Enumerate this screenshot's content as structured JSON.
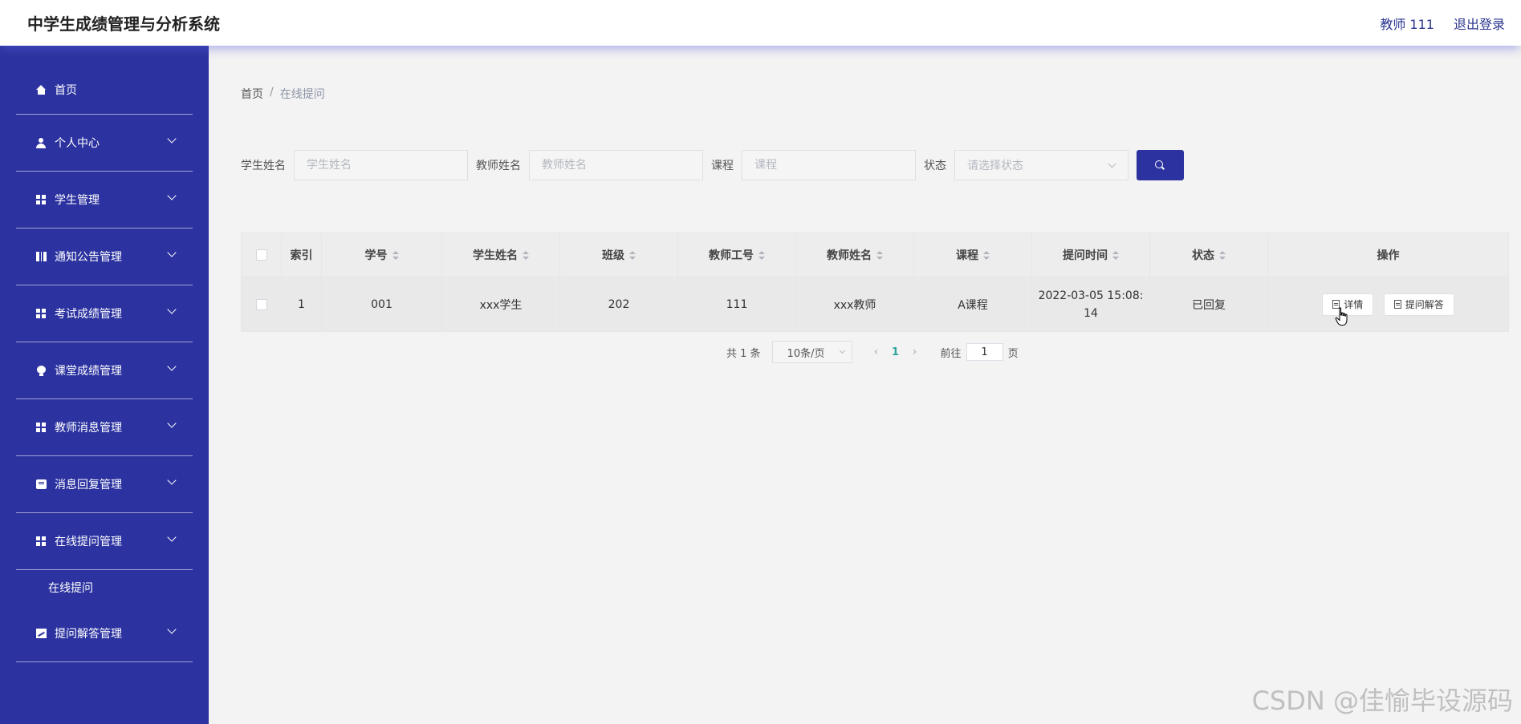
{
  "header": {
    "title": "中学生成绩管理与分析系统",
    "user": "教师 111",
    "logout": "退出登录"
  },
  "sidebar": {
    "items": [
      {
        "label": "首页",
        "icon": "home-icon"
      },
      {
        "label": "个人中心",
        "icon": "user-icon"
      },
      {
        "label": "学生管理",
        "icon": "grid-icon"
      },
      {
        "label": "通知公告管理",
        "icon": "book-icon"
      },
      {
        "label": "考试成绩管理",
        "icon": "grid-icon"
      },
      {
        "label": "课堂成绩管理",
        "icon": "bulb-icon"
      },
      {
        "label": "教师消息管理",
        "icon": "grid-icon"
      },
      {
        "label": "消息回复管理",
        "icon": "chat-icon"
      },
      {
        "label": "在线提问管理",
        "icon": "grid-icon",
        "submenu": [
          "在线提问"
        ]
      },
      {
        "label": "提问解答管理",
        "icon": "chart-icon"
      }
    ]
  },
  "breadcrumb": {
    "home": "首页",
    "separator": "/",
    "current": "在线提问"
  },
  "search": {
    "student_label": "学生姓名",
    "student_placeholder": "学生姓名",
    "teacher_label": "教师姓名",
    "teacher_placeholder": "教师姓名",
    "course_label": "课程",
    "course_placeholder": "课程",
    "status_label": "状态",
    "status_placeholder": "请选择状态"
  },
  "table": {
    "columns": [
      "索引",
      "学号",
      "学生姓名",
      "班级",
      "教师工号",
      "教师姓名",
      "课程",
      "提问时间",
      "状态",
      "操作"
    ],
    "rows": [
      {
        "index": "1",
        "student_id": "001",
        "student_name": "xxx学生",
        "class": "202",
        "teacher_id": "111",
        "teacher_name": "xxx教师",
        "course": "A课程",
        "time_line1": "2022-03-05 15:08:",
        "time_line2": "14",
        "status": "已回复",
        "action_detail": "详情",
        "action_answer": "提问解答"
      }
    ]
  },
  "pagination": {
    "total": "共 1 条",
    "page_size": "10条/页",
    "current_page": "1",
    "goto_label": "前往",
    "goto_value": "1",
    "goto_suffix": "页"
  },
  "watermark": "CSDN @佳愉毕设源码",
  "colors": {
    "sidebar_bg": "#2c33a0",
    "accent": "#2c33a0",
    "active_page": "#2aa59a"
  }
}
